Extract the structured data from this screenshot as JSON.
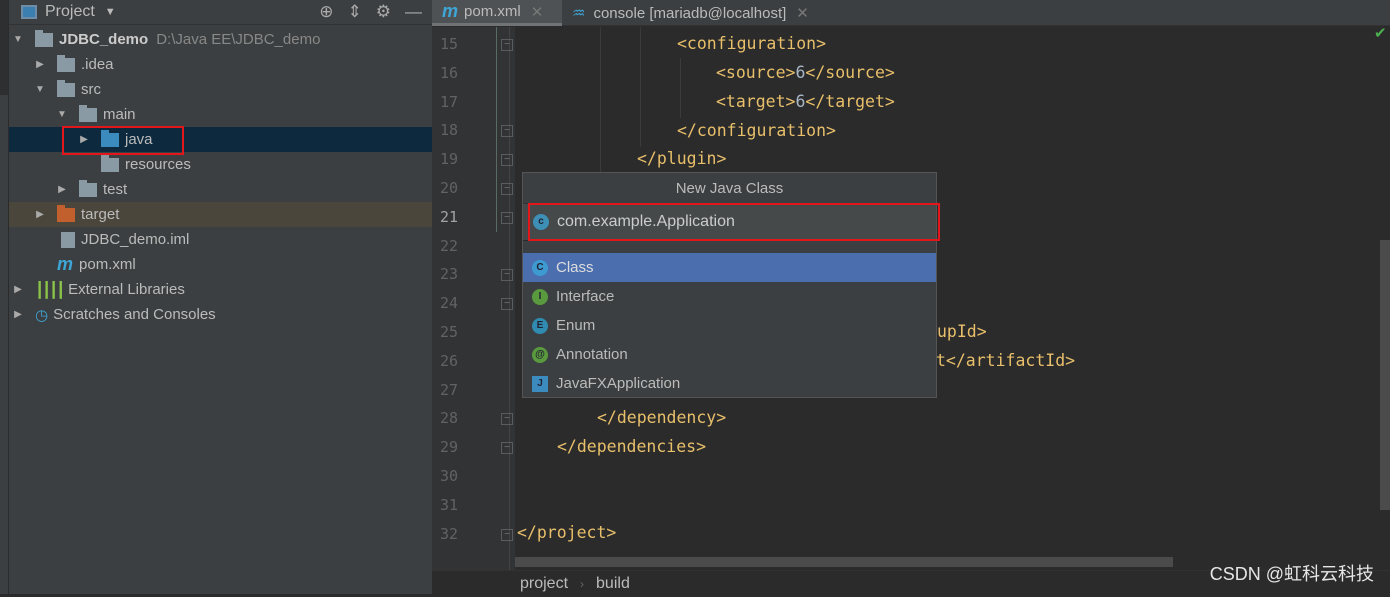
{
  "project_panel": {
    "title": "Project",
    "tree": [
      {
        "label": "JDBC_demo",
        "path": "D:\\Java EE\\JDBC_demo"
      },
      {
        "label": ".idea"
      },
      {
        "label": "src"
      },
      {
        "label": "main"
      },
      {
        "label": "java"
      },
      {
        "label": "resources"
      },
      {
        "label": "test"
      },
      {
        "label": "target"
      },
      {
        "label": "JDBC_demo.iml"
      },
      {
        "label": "pom.xml"
      },
      {
        "label": "External Libraries"
      },
      {
        "label": "Scratches and Consoles"
      }
    ]
  },
  "tabs": [
    {
      "label": "pom.xml",
      "icon": "maven-icon"
    },
    {
      "label": "console [mariadb@localhost]",
      "icon": "mysql-icon"
    }
  ],
  "editor": {
    "line_numbers": [
      "15",
      "16",
      "17",
      "18",
      "19",
      "20",
      "21",
      "22",
      "23",
      "24",
      "25",
      "26",
      "27",
      "28",
      "29",
      "30",
      "31",
      "32"
    ],
    "code": {
      "l15": "<configuration>",
      "l16a": "<source>",
      "l16b": "6",
      "l16c": "</source>",
      "l17a": "<target>",
      "l17b": "6",
      "l17c": "</target>",
      "l18": "</configuration>",
      "l19": "</plugin>",
      "l25": "upId>",
      "l26": "t</artifactId>",
      "l28": "</dependency>",
      "l29": "</dependencies>",
      "l32": "</project>"
    }
  },
  "popup": {
    "title": "New Java Class",
    "input_value": "com.example.Application",
    "items": [
      {
        "label": "Class",
        "letter": "C",
        "color": "#3d9bd1"
      },
      {
        "label": "Interface",
        "letter": "I",
        "color": "#5a9a3e"
      },
      {
        "label": "Enum",
        "letter": "E",
        "color": "#2f8bb0"
      },
      {
        "label": "Annotation",
        "letter": "@",
        "color": "#5a9a3e"
      },
      {
        "label": "JavaFXApplication",
        "letter": "J",
        "color": "#3b8bbf"
      }
    ],
    "selected": "Class"
  },
  "breadcrumb": [
    "project",
    "build"
  ],
  "watermark": "CSDN @虹科云科技",
  "colors": {
    "highlight_box": "#e3161c",
    "selection": "#4b6eaf",
    "tag": "#e8bf6a"
  }
}
